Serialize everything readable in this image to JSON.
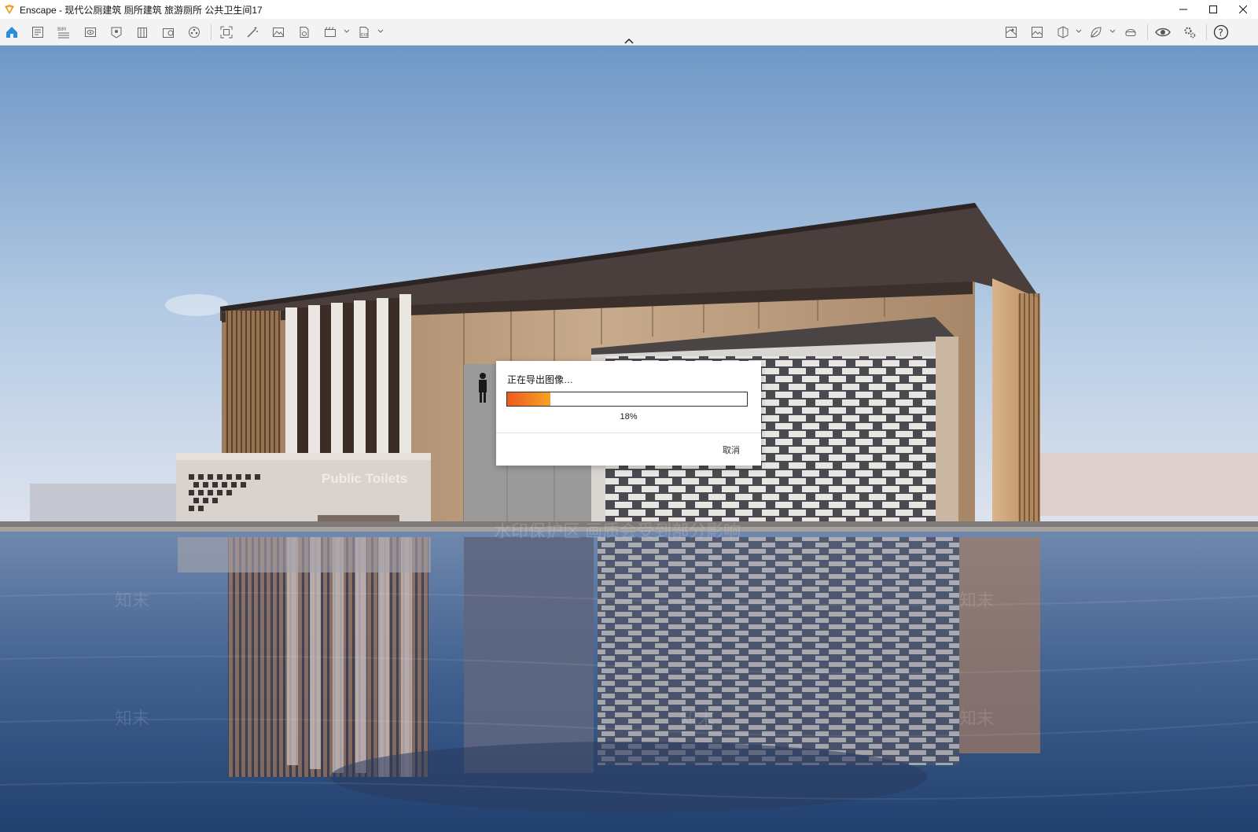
{
  "window": {
    "app_name": "Enscape",
    "title": "Enscape - 现代公厕建筑 厕所建筑 旅游厕所 公共卫生间17"
  },
  "toolbar": {
    "left_icons": [
      "home-icon",
      "project-icon",
      "bim-icon",
      "views-icon",
      "asset-icon",
      "building-icon",
      "upload-icon",
      "material-icon",
      "capture-icon",
      "magic-icon",
      "image-icon",
      "batch-icon",
      "video-icon",
      "export-icon"
    ],
    "right_icons": [
      "site-context-icon",
      "gallery-icon",
      "cube-icon",
      "leaf-icon",
      "vr-icon",
      "eye-icon",
      "settings-icon",
      "help-icon"
    ]
  },
  "scene": {
    "sign_text": "Public Toilets",
    "watermarks": [
      "水印保护区  画质会受到部分影响",
      "知末",
      "知末",
      "知末",
      "知末",
      "知末"
    ]
  },
  "dialog": {
    "title": "正在导出图像…",
    "progress_percent": 18,
    "progress_label": "18%",
    "cancel_label": "取消"
  },
  "colors": {
    "accent": "#f08a1c",
    "progress_start": "#ee5a1e",
    "progress_end": "#f7a225"
  }
}
